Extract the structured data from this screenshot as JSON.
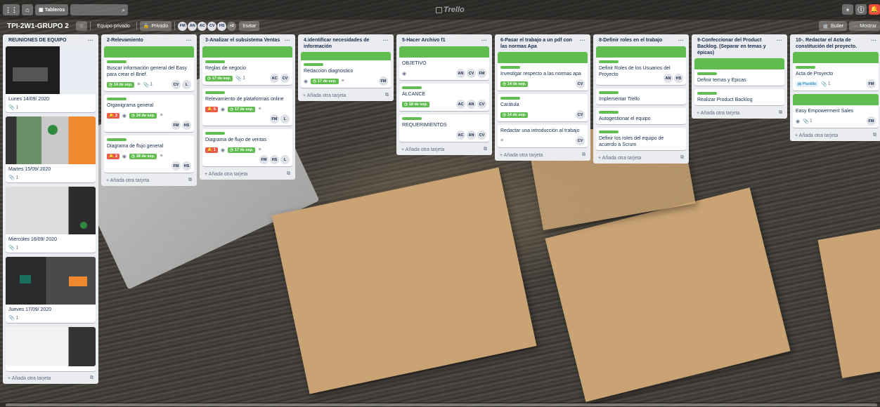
{
  "topbar": {
    "boards_label": "Tableros",
    "search_placeholder": "",
    "logo_text": "Trello"
  },
  "board": {
    "title": "TPI-2W1-GRUPO 2",
    "team_label": "Equipo privado",
    "privacy_label": "Privado",
    "members": [
      "FM",
      "AN",
      "AC",
      "CV",
      "HS"
    ],
    "extra_members": "+2",
    "invite_label": "Invitar",
    "butler_label": "Butler",
    "show_menu_label": "Mostrar"
  },
  "add_card_label": "Añada otra tarjeta",
  "lists": [
    {
      "title": "REUNIONES DE EQUIPO",
      "cards": [
        {
          "title": "Lunes 14/09/ 2020",
          "attachments": "1"
        },
        {
          "title": "Martes 15/09/ 2020",
          "attachments": "1"
        },
        {
          "title": "Miercoles 16/09/ 2020",
          "attachments": "1"
        },
        {
          "title": "Jueves 17/09/ 2020",
          "attachments": "1"
        },
        {
          "title": "",
          "attachments": ""
        }
      ]
    },
    {
      "title": "2-Relevamiento",
      "cards": [
        {
          "title": "Buscar información general del Easy para crear el Brief.",
          "due": "14 de sep.",
          "attachments": "1",
          "members": [
            "CV",
            "L"
          ]
        },
        {
          "title": "Organigrama general",
          "alert": "3",
          "due": "24 de sep.",
          "members": [
            "FM",
            "HS"
          ]
        },
        {
          "title": "Diagrama de flujo general",
          "alert": "3",
          "due": "28 de sep.",
          "members": [
            "FM",
            "HS"
          ]
        }
      ]
    },
    {
      "title": "3-Analizar el subsistema Ventas",
      "cards": [
        {
          "title": "Reglas de negocio",
          "due": "17 de sep.",
          "attachments": "1",
          "members": [
            "AC",
            "CV"
          ]
        },
        {
          "title": "Relevamiento de plataformas online",
          "alert": "5",
          "due": "17 de sep.",
          "members": [
            "FM",
            "L"
          ]
        },
        {
          "title": "Diagrama de flujo de ventas",
          "alert": "1",
          "due": "17 de sep.",
          "members": [
            "FM",
            "HS",
            "L"
          ]
        }
      ]
    },
    {
      "title": "4.identificar necesidades de información",
      "cards": [
        {
          "title": "Redaccion diagnostico",
          "due": "17 de sep.",
          "members": [
            "FM"
          ]
        }
      ]
    },
    {
      "title": "5-Hacer Archivo f1",
      "cards": [
        {
          "title": "OBJETIVO",
          "members": [
            "AN",
            "CV",
            "FM"
          ]
        },
        {
          "title": "ALCANCE",
          "due": "18 de sep.",
          "members": [
            "AC",
            "AN",
            "CV"
          ]
        },
        {
          "title": "REQUERIMIENTOS",
          "members": [
            "AC",
            "AN",
            "CV"
          ]
        }
      ]
    },
    {
      "title": "6-Pasar el trabajo a un pdf con las normas Apa",
      "cards": [
        {
          "title": "Investigar respecto a las normas apa",
          "due": "14 de sep.",
          "members": [
            "CV"
          ]
        },
        {
          "title": "Carátula",
          "due": "14 de sep.",
          "members": [
            "CV"
          ]
        },
        {
          "title": "Redactar una introducción al trabajo",
          "members": [
            "CV"
          ]
        }
      ]
    },
    {
      "title": "8-Definir roles en el trabajo",
      "cards": [
        {
          "title": "Definir Roles de los Usuarios del Proyecto",
          "members": [
            "AN",
            "HS"
          ]
        },
        {
          "title": "Implementar Trello"
        },
        {
          "title": "Autogestionar el equipo"
        },
        {
          "title": "Definir los roles del equipo de acuerdo a Scrum"
        }
      ]
    },
    {
      "title": "9-Confeccionar del Product Backlog. (Separar en temas y épicas)",
      "cards": [
        {
          "title": "Definir temas y Epicas"
        },
        {
          "title": "Realizar Product Backlog"
        }
      ]
    },
    {
      "title": "10-. Redactar el Acta de constitución del proyecto.",
      "cards": [
        {
          "title": "Acta de Proyecto",
          "badge": "Plantilla",
          "attachments": "1",
          "members": [
            "FM"
          ]
        },
        {
          "title": "Easy Empowerment Sales",
          "attachments": "1",
          "members": [
            "FM"
          ]
        }
      ]
    }
  ],
  "colors": {
    "label_green": "#61bd4f",
    "due_green": "#61bd4f",
    "alert_red": "#eb5a46"
  }
}
